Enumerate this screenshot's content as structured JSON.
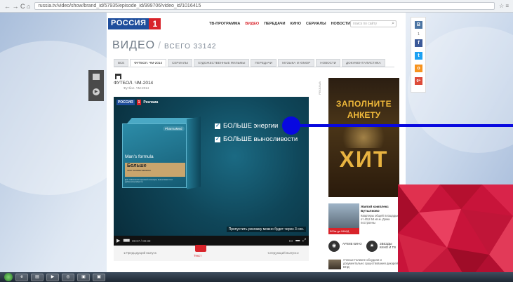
{
  "browser": {
    "url": "russia.tv/video/show/brand_id/57935/episode_id/999706/video_id/1016415",
    "nav": "← → C ⌂",
    "right_icons": "☆ ≡"
  },
  "site": {
    "logo_word": "РОССИЯ",
    "logo_num": "1",
    "topnav": [
      "ТВ-ПРОГРАММА",
      "ВИДЕО",
      "ПЕРЕДАЧИ",
      "КИНО",
      "СЕРИАЛЫ",
      "НОВОСТИ"
    ],
    "search_placeholder": "поиск по сайту"
  },
  "page": {
    "title": "ВИДЕО",
    "slash": "/",
    "count": "ВСЕГО 33142",
    "tabs": [
      "ВСЕ",
      "ФУТБОЛ. ЧМ-2014",
      "СЕРИАЛЫ",
      "ХУДОЖЕСТВЕННЫЕ ФИЛЬМЫ",
      "ПЕРЕДАЧИ",
      "МУЗЫКА И ЮМОР",
      "НОВОСТИ",
      "ДОКУМЕНТАЛИСТИКА"
    ],
    "active_tab": "ФУТБОЛ. ЧМ-2014",
    "crumb_title": "ФУТБОЛ. ЧМ-2014",
    "crumb_sub": "Футбол. ЧМ-2014",
    "side_label": "РЕКЛАМА"
  },
  "player": {
    "logo_word": "РОССИЯ",
    "logo_num": "1",
    "ad_label": "Реклама",
    "pack_brand": "PharmaMed",
    "pack_name": "Man's formula",
    "pack_band1": "Больше",
    "pack_band2": "чем поливитамины",
    "pack_fine": "Для повышения мужской потенции, выносливости и работоспособности",
    "claims": [
      "БОЛЬШЕ энергии",
      "БОЛЬШЕ выносливости"
    ],
    "skip_text": "Пропустить рекламу можно будет через 3 сек.",
    "time": "00:07 / 00:30",
    "prev": "◂ Предыдущий выпуск",
    "next": "Следующий выпуск ▸",
    "text_btn": "Текст"
  },
  "sidebar": {
    "ad_line1": "ЗАПОЛНИТЕ",
    "ad_line2": "АНКЕТУ",
    "ad_big": "ХИТ",
    "news1_title": "Жилой комплекс Бутылково",
    "news1_text": "Квартиры общей площадью от 40,8 54 кв.м. Дома построены",
    "news1_bar": "500м до МКАД",
    "cat1": "АРХИВ КИНО",
    "cat2": "ЗВЕЗДЫ КИНО И ТВ",
    "news2_text": "Ученые Голиопе обсудили и документально существования дикарей ВНД"
  },
  "social": {
    "count": "1",
    "items": [
      "В",
      "f",
      "t",
      "о",
      "g+"
    ],
    "colors": [
      "#4c75a3",
      "#3b5998",
      "#1da1f2",
      "#f7931e",
      "#dd4b39"
    ]
  },
  "colors": {
    "accent_red": "#d8232a",
    "brand_blue": "#1f4e9c",
    "annotation_blue": "#0808e0"
  }
}
